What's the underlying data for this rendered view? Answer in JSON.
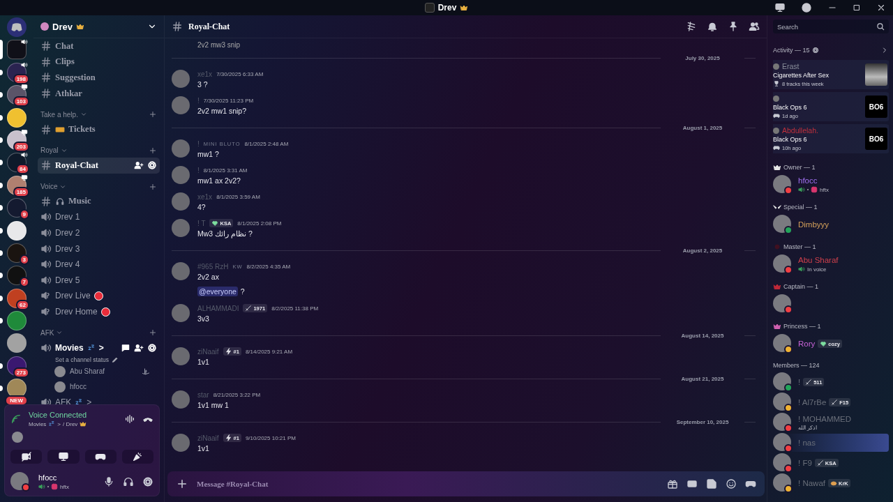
{
  "titlebar": {
    "title": "Drev"
  },
  "rail": {
    "servers": [
      {
        "kind": "home",
        "unread": false,
        "selected": false
      },
      {
        "kind": "server",
        "unread": true,
        "selected": true
      },
      {
        "kind": "server",
        "badge": "198",
        "unread": true,
        "selected": false
      },
      {
        "kind": "server",
        "badge": "103",
        "unread": true,
        "selected": false
      },
      {
        "kind": "server",
        "unread": true,
        "selected": false
      },
      {
        "kind": "server",
        "badge": "203",
        "unread": true,
        "selected": false
      },
      {
        "kind": "server",
        "badge": "84",
        "unread": true,
        "selected": false
      },
      {
        "kind": "server",
        "badge": "185",
        "unread": true,
        "selected": false
      },
      {
        "kind": "server",
        "badge": "9",
        "unread": true,
        "selected": false
      },
      {
        "kind": "server",
        "unread": true,
        "selected": false
      },
      {
        "kind": "server",
        "badge": "3",
        "unread": true,
        "selected": false
      },
      {
        "kind": "server",
        "badge": "7",
        "unread": true,
        "selected": false
      },
      {
        "kind": "server",
        "badge": "62",
        "unread": true,
        "selected": false
      },
      {
        "kind": "server",
        "unread": true,
        "selected": false
      },
      {
        "kind": "server",
        "unread": false,
        "selected": false
      },
      {
        "kind": "server",
        "badge": "273",
        "unread": true,
        "selected": false
      },
      {
        "kind": "server",
        "badge": "NEW",
        "unread": true,
        "selected": false
      }
    ]
  },
  "sidebar": {
    "server_name": "Drev",
    "top": [
      {
        "kind": "text",
        "name": "Chat",
        "selected": false
      },
      {
        "kind": "text",
        "name": "Clips",
        "selected": false
      },
      {
        "kind": "text",
        "name": "Suggestion",
        "selected": false
      },
      {
        "kind": "text",
        "name": "Athkar",
        "selected": false
      }
    ],
    "categories": [
      {
        "name": "Take a help.",
        "channels": [
          {
            "kind": "ticket",
            "name": "Tickets",
            "selected": false
          }
        ]
      },
      {
        "name": "Royal",
        "channels": [
          {
            "kind": "text",
            "name": "Royal-Chat",
            "selected": true
          }
        ]
      },
      {
        "name": "Voice",
        "channels": [
          {
            "kind": "music",
            "name": "Music",
            "selected": false
          },
          {
            "kind": "voice",
            "name": "Drev 1",
            "selected": false
          },
          {
            "kind": "voice",
            "name": "Drev 2",
            "selected": false
          },
          {
            "kind": "voice",
            "name": "Drev 3",
            "selected": false
          },
          {
            "kind": "voice",
            "name": "Drev 4",
            "selected": false
          },
          {
            "kind": "voice",
            "name": "Drev 5",
            "selected": false
          },
          {
            "kind": "stage",
            "name": "Drev Live",
            "selected": false
          },
          {
            "kind": "stage",
            "name": "Drev Home",
            "selected": false
          }
        ]
      },
      {
        "name": "AFK",
        "channels": [
          {
            "kind": "voice",
            "name": "Movies",
            "tail": ">",
            "selected": false,
            "active": true,
            "status": "Set a channel status",
            "members": [
              {
                "name": "Abu Sharaf",
                "console": true
              },
              {
                "name": "hfocc",
                "console": false
              }
            ]
          },
          {
            "kind": "voice",
            "name": "AFK",
            "tail": ">",
            "selected": false,
            "active": false
          }
        ]
      }
    ]
  },
  "voice_panel": {
    "title": "Voice Connected",
    "channel": "Movies",
    "tail": ">",
    "server": "/ Drev"
  },
  "user_panel": {
    "name": "hfocc",
    "activity": "hftx",
    "status": {
      "color": "#f23f43"
    }
  },
  "chat": {
    "channel": "Royal-Chat",
    "search_placeholder": "Search",
    "composer_placeholder": "Message #Royal-Chat",
    "items": [
      {
        "kind": "continuation",
        "lines": [
          {
            "text": "2v2 mw3 snip"
          }
        ]
      },
      {
        "kind": "divider",
        "date": "July 30, 2025"
      },
      {
        "kind": "message",
        "author": "xe1x",
        "time": "7/30/2025 6:33 AM",
        "lines": [
          {
            "text": "3 ?"
          }
        ]
      },
      {
        "kind": "message",
        "author": "!",
        "time": "7/30/2025 11:23 PM",
        "lines": [
          {
            "text": "2v2 mw1 snip?"
          }
        ]
      },
      {
        "kind": "divider",
        "date": "August 1, 2025"
      },
      {
        "kind": "message",
        "author": "!",
        "extra": "MINI BLUTO",
        "time": "8/1/2025 2:48 AM",
        "lines": [
          {
            "text": "mw1 ?"
          }
        ]
      },
      {
        "kind": "message",
        "author": "!",
        "time": "8/1/2025 3:31 AM",
        "lines": [
          {
            "text": "mw1 ax 2v2?"
          }
        ]
      },
      {
        "kind": "message",
        "author": "xe1x",
        "time": "8/1/2025 3:59 AM",
        "lines": [
          {
            "text": "4?"
          }
        ]
      },
      {
        "kind": "message",
        "author": "! T",
        "tag": {
          "kind": "heart",
          "text": "KSA"
        },
        "time": "8/1/2025 2:08 PM",
        "lines": [
          {
            "text": "Mw3 نظام رائك ?"
          }
        ]
      },
      {
        "kind": "divider",
        "date": "August 2, 2025"
      },
      {
        "kind": "message",
        "author": "#965 RzH",
        "extra": "KW",
        "time": "8/2/2025 4:35 AM",
        "lines": [
          {
            "text": "2v2 ax"
          },
          {
            "mention": "@everyone",
            "text": "?"
          }
        ]
      },
      {
        "kind": "message",
        "author": "ALHAMMADI",
        "tag": {
          "kind": "sword",
          "text": "1971"
        },
        "time": "8/2/2025 11:38 PM",
        "lines": [
          {
            "text": "3v3"
          }
        ]
      },
      {
        "kind": "divider",
        "date": "August 14, 2025"
      },
      {
        "kind": "message",
        "author": "ziNaaif",
        "tag": {
          "kind": "bolt",
          "text": "#1"
        },
        "time": "8/14/2025 9:21 AM",
        "lines": [
          {
            "text": "1v1"
          }
        ]
      },
      {
        "kind": "divider",
        "date": "August 21, 2025"
      },
      {
        "kind": "message",
        "author": "star",
        "time": "8/21/2025 3:22 PM",
        "lines": [
          {
            "text": "1v1 mw 1"
          }
        ]
      },
      {
        "kind": "divider",
        "date": "September 10, 2025"
      },
      {
        "kind": "message",
        "author": "ziNaaif",
        "tag": {
          "kind": "bolt",
          "text": "#1"
        },
        "time": "9/10/2025 10:21 PM",
        "lines": [
          {
            "text": "1v1"
          }
        ]
      }
    ]
  },
  "members": {
    "activity": {
      "title": "Activity — 15",
      "cards": [
        {
          "kind": "music",
          "user": "Erast",
          "color": "#8a8f9a",
          "title": "Cigarettes After Sex",
          "detail": "8 tracks this week"
        },
        {
          "kind": "game",
          "title": "Black Ops 6",
          "detail": "1d ago",
          "art_text": "BO6"
        },
        {
          "kind": "game",
          "user": "Abdullelah.",
          "color": "#c0303c",
          "title": "Black Ops 6",
          "detail": "10h ago",
          "art_text": "BO6"
        }
      ]
    },
    "groups": [
      {
        "name": "Owner — 1",
        "kind": "crown",
        "color": "#e8e8e8",
        "members": [
          {
            "kind": "social",
            "name": "hfocc",
            "color": "#a070f0",
            "status": {
              "color": "#f23f43"
            },
            "sub": "hftx",
            "nameplate": false
          }
        ]
      },
      {
        "name": "Special — 1",
        "kind": "wings",
        "color": "#e8e8e8",
        "members": [
          {
            "kind": "plain",
            "name": "Dimbyyy",
            "color": "#d4a05a",
            "status": {
              "color": "#23a55a"
            },
            "nameplate": false
          }
        ]
      },
      {
        "name": "Master — 1",
        "kind": "dot",
        "color": "#401020",
        "members": [
          {
            "kind": "voice",
            "name": "Abu Sharaf",
            "color": "#d0404c",
            "status": {
              "color": "#f23f43"
            },
            "sub": "In voice",
            "nameplate": false
          }
        ]
      },
      {
        "name": "Captain — 1",
        "kind": "crown",
        "color": "#c02838",
        "members": [
          {
            "kind": "plain",
            "status": {
              "color": "#f23f43"
            },
            "nameplate": false
          }
        ]
      },
      {
        "name": "Princess — 1",
        "kind": "crown",
        "color": "#d060b0",
        "members": [
          {
            "kind": "plain",
            "name": "Rory",
            "color": "#c864d8",
            "status": {
              "color": "#f0b232"
            },
            "tag": {
              "kind": "heart",
              "text": "cozy"
            },
            "nameplate": false
          }
        ]
      },
      {
        "name": "Members — 124",
        "members": [
          {
            "kind": "plain",
            "name": "!",
            "color": "#6a6f7a",
            "status": {
              "color": "#23a55a"
            },
            "tag": {
              "kind": "sword",
              "text": "511"
            },
            "nameplate": false
          },
          {
            "kind": "plain",
            "name": "! Al7rBe",
            "color": "#6a6f7a",
            "status": {
              "color": "#f0b232"
            },
            "tag": {
              "kind": "sword",
              "text": "F15"
            },
            "nameplate": false
          },
          {
            "kind": "plain",
            "name": "! MOHAMMED",
            "color": "#6a6f7a",
            "status": {
              "color": "#f23f43"
            },
            "sub": "اذكر الله",
            "nameplate": false
          },
          {
            "kind": "plain",
            "name": "! nas",
            "color": "#6a6f7a",
            "status": {
              "color": "#f23f43"
            },
            "nameplate": true
          },
          {
            "kind": "plain",
            "name": "! F9",
            "color": "#6a6f7a",
            "status": {
              "color": "#f23f43"
            },
            "tag": {
              "kind": "sword",
              "text": "KSA"
            },
            "nameplate": false
          },
          {
            "kind": "plain",
            "name": "! Nawaf",
            "color": "#6a6f7a",
            "status": {
              "color": "#f0b232"
            },
            "tag": {
              "kind": "food",
              "text": "KrK"
            },
            "nameplate": false
          }
        ]
      }
    ]
  }
}
